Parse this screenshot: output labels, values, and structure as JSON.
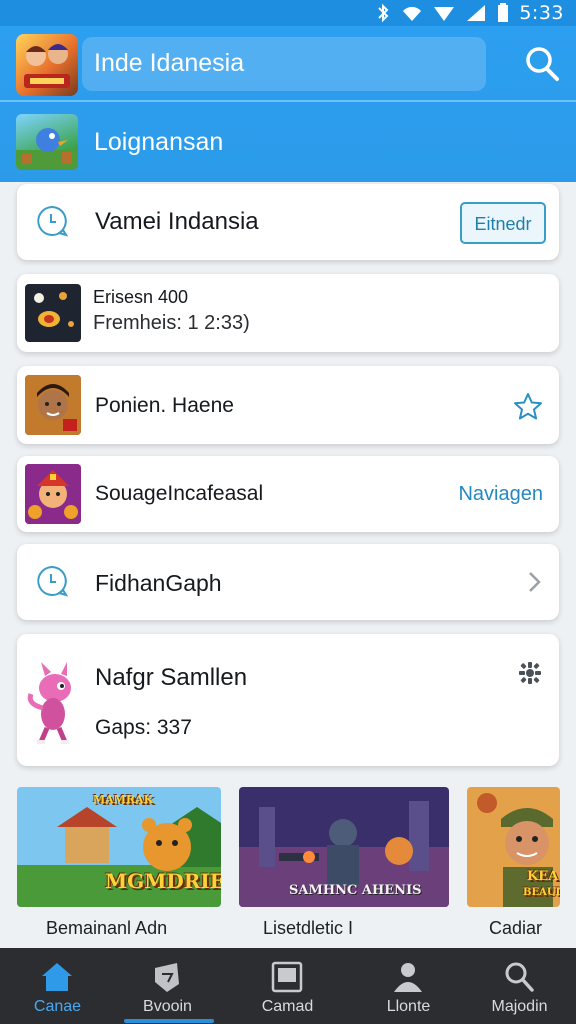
{
  "status_bar": {
    "time": "5:33"
  },
  "header": {
    "search_text": "Inde Idanesia",
    "subtitle": "Loignansan"
  },
  "cards": {
    "welcome": {
      "title": "Vamei Indansia",
      "button_label": "Eitnedr"
    },
    "event": {
      "line1": "Erisesn 400",
      "line2": "Fremheis: 1 2:33)"
    },
    "hero": {
      "title": "Ponien. Haene"
    },
    "shop": {
      "title": "SouageIncafeasal",
      "link_label": "Naviagen"
    },
    "find": {
      "title": "FidhanGaph"
    },
    "profile": {
      "name": "Nafgr Samllen",
      "stats": "Gaps: 337"
    }
  },
  "tiles": [
    {
      "overlay": "MAMRAK\nMGMDRIES",
      "caption": "Bemainanl Adn"
    },
    {
      "overlay": "SAMHNC AHENIS",
      "caption": "Lisetdletic I"
    },
    {
      "overlay": "KEA\nBEAUD",
      "caption": "Cadiar"
    }
  ],
  "bottom_nav": [
    {
      "label": "Canae",
      "icon": "home-icon",
      "active": true
    },
    {
      "label": "Bvooin",
      "icon": "shield-icon",
      "active": false
    },
    {
      "label": "Camad",
      "icon": "frame-icon",
      "active": false
    },
    {
      "label": "Llonte",
      "icon": "person-icon",
      "active": false
    },
    {
      "label": "Majodin",
      "icon": "search-icon",
      "active": false
    }
  ],
  "colors": {
    "header": "#2b9be9",
    "accent": "#2389bf",
    "nav_bg": "#2b2d31",
    "nav_active": "#2b8fd8"
  }
}
